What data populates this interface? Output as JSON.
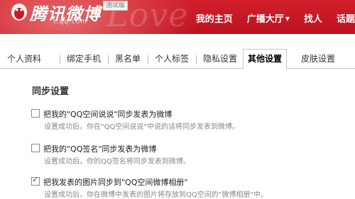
{
  "header": {
    "logo_text": "腾讯微博",
    "logo_domain": "t.qq.com",
    "beta_label": "测试版",
    "watermark": "Love",
    "nav": [
      "我的主页",
      "广播大厅",
      "找人",
      "话题"
    ],
    "nav_caret": "▼",
    "brand_color": "#c8182a"
  },
  "tabs": [
    {
      "label": "个人资料"
    },
    {
      "label": "绑定手机"
    },
    {
      "label": "黑名单"
    },
    {
      "label": "个人标签"
    },
    {
      "label": "隐私设置"
    },
    {
      "label": "其他设置",
      "active": true
    },
    {
      "label": "皮肤设置"
    }
  ],
  "sync": {
    "title": "同步设置",
    "options": [
      {
        "label": "把我的\"QQ空间说说\"同步发表为微博",
        "checked": false,
        "desc": "设置成功后，你在\"QQ空间说说\"中说的话将同步发表到微博。"
      },
      {
        "label": "把我的\"QQ签名\"同步发表为微博",
        "checked": false,
        "desc": "设置成功后，你的QQ签名将同步发表到微博。"
      },
      {
        "label": "把我发表的图片同步到\"QQ空间微博相册\"",
        "checked": true,
        "desc": "设置成功后，你在微博中发表的图片将存放到QQ空间的\"微博相册\"中。"
      }
    ]
  }
}
